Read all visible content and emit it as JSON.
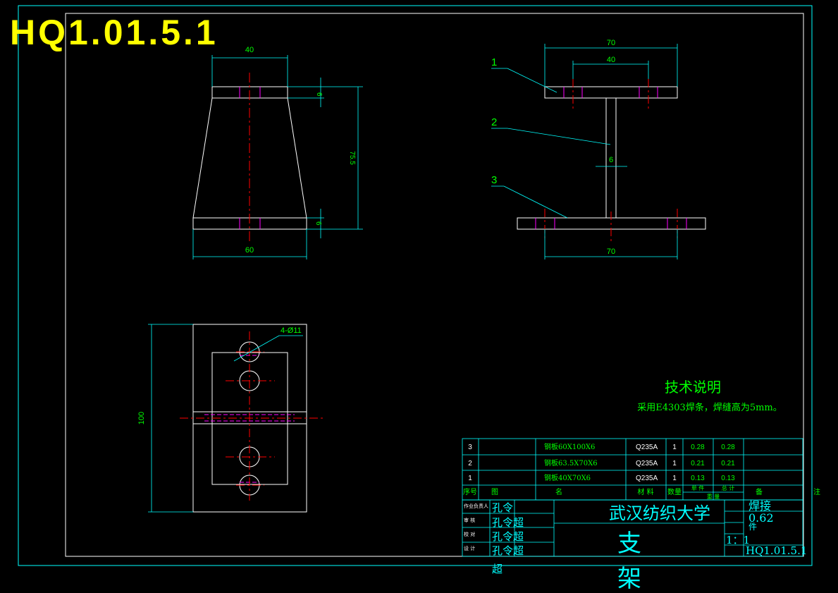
{
  "drawing_no": "HQ1.01.5.1",
  "colors": {
    "background": "#000000",
    "frame": "#00ffff",
    "outline": "#ffffff",
    "centerline": "#ff0000",
    "dimension": "#00ff00",
    "hidden": "#ff00ff",
    "title_yellow": "#ffff00"
  },
  "front_view": {
    "dim_top_width": "40",
    "dim_bottom_width": "60",
    "dim_top_thickness": "6",
    "dim_bottom_thickness": "6",
    "dim_height": "75.5"
  },
  "side_view": {
    "dim_overall_top": "70",
    "dim_hole_spacing": "40",
    "dim_web": "6",
    "dim_bottom": "70",
    "callouts": [
      "1",
      "2",
      "3"
    ]
  },
  "top_view": {
    "dim_height": "100",
    "hole_note": "4-Ø11"
  },
  "tech_notes": {
    "heading": "技术说明",
    "text": "采用E4303焊条，焊缝高为5mm。"
  },
  "bom": {
    "rows": [
      {
        "no": "3",
        "name": "钢板60X100X6",
        "material": "Q235A",
        "qty": "1",
        "unit": "0.28",
        "total": "0.28"
      },
      {
        "no": "2",
        "name": "钢板63.5X70X6",
        "material": "Q235A",
        "qty": "1",
        "unit": "0.21",
        "total": "0.21"
      },
      {
        "no": "1",
        "name": "钢板40X70X6",
        "material": "Q235A",
        "qty": "1",
        "unit": "0.13",
        "total": "0.13"
      }
    ],
    "header": {
      "no": "序号",
      "drawing": "图",
      "name": "名",
      "material": "材 料",
      "qty": "数量",
      "single": "单 件",
      "total": "总 计",
      "weight": "重 量",
      "remark": "备",
      "note": "注"
    }
  },
  "title_block": {
    "school": "武汉纺织大学",
    "part_name_1": "支",
    "part_name_2": "架",
    "process": "焊接",
    "weight": "0.62",
    "sheet_label": "件",
    "scale_value": "1：1",
    "roles": [
      "作业负责人",
      "审 核",
      "校 对",
      "设 计"
    ],
    "names": [
      "孔令",
      "孔令",
      "孔令",
      "孔令"
    ],
    "names_stack": [
      "孔令",
      "孔令超",
      "孔令超",
      "孔令超",
      "超"
    ]
  }
}
